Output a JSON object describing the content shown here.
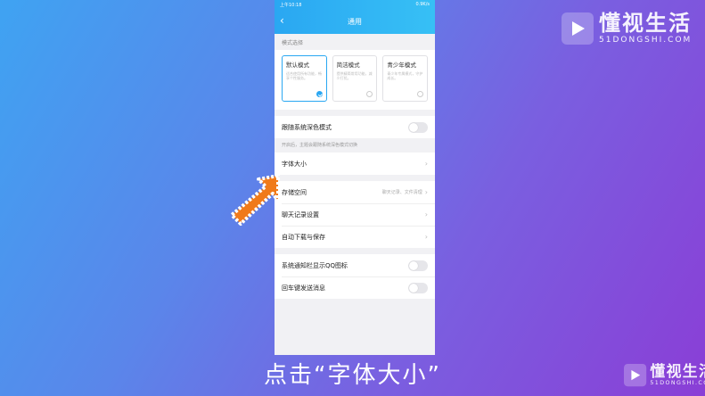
{
  "watermark": {
    "brand": "懂视生活",
    "domain": "51DONGSHI.COM"
  },
  "statusbar": {
    "left": "上午10:18",
    "right": "0.9K/s"
  },
  "nav": {
    "title": "通用"
  },
  "mode_section": {
    "label": "模式选择",
    "cards": [
      {
        "title": "默认模式",
        "desc": "适合使用所有功能，畅享个性服务。",
        "selected": true
      },
      {
        "title": "简洁模式",
        "desc": "提供精简常用功能，减少打扰。",
        "selected": false
      },
      {
        "title": "青少年模式",
        "desc": "青少年专属模式，守护成长。",
        "selected": false
      }
    ]
  },
  "dark_mode": {
    "label": "跟随系统深色模式",
    "hint": "开启后，主题会跟随系统深色模式切换",
    "on": false
  },
  "rows": {
    "font_size": "字体大小",
    "storage": "存储空间",
    "storage_value": "聊天记录、文件清理",
    "chat_settings": "聊天记录设置",
    "auto_download": "自动下载与保存"
  },
  "toggles": {
    "qq_icon": "系统通知栏显示QQ图标",
    "enter_send": "回车键发送消息"
  },
  "caption": "点击“字体大小”",
  "colors": {
    "accent": "#2aa7f2",
    "arrow": "#f07a1a"
  }
}
